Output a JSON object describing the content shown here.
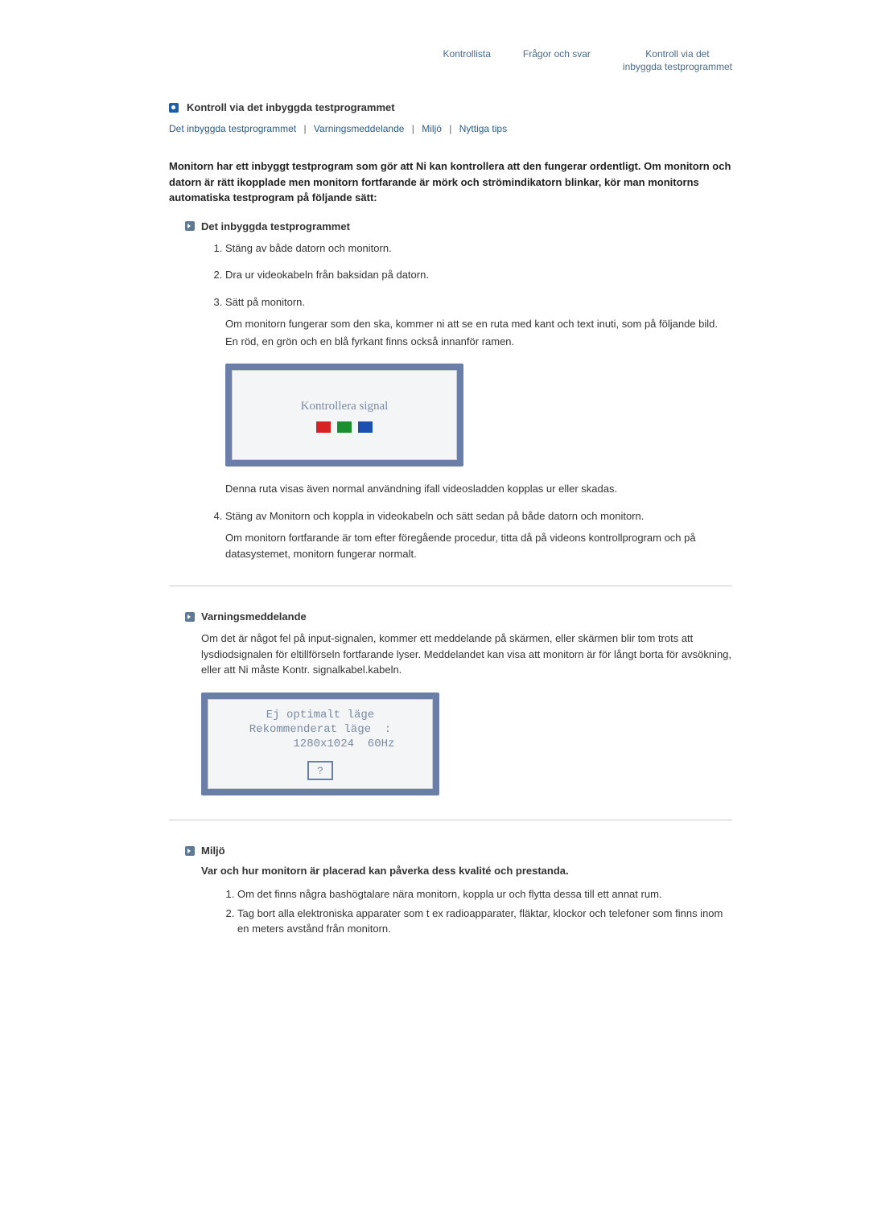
{
  "topnav": {
    "item1": "Kontrollista",
    "item2": "Frågor och svar",
    "item3_line1": "Kontroll via det",
    "item3_line2": "inbyggda testprogrammet"
  },
  "page_title": "Kontroll via det inbyggda testprogrammet",
  "jump_links": {
    "a": "Det inbyggda testprogrammet",
    "b": "Varningsmeddelande",
    "c": "Miljö",
    "d": "Nyttiga tips"
  },
  "intro": "Monitorn har ett inbyggt testprogram som gör att Ni kan kontrollera att den fungerar ordentligt. Om monitorn och datorn är rätt ikopplade men monitorn fortfarande är mörk och strömindikatorn blinkar, kör man monitorns automatiska testprogram på följande sätt:",
  "section1": {
    "heading": "Det inbyggda testprogrammet",
    "step1": "Stäng av både datorn och monitorn.",
    "step2": "Dra ur videokabeln från baksidan på datorn.",
    "step3": "Sätt på monitorn.",
    "step3_p1": "Om monitorn fungerar som den ska, kommer ni att se en ruta med kant och text inuti, som på följande bild.",
    "step3_p2": "En röd, en grön och en blå fyrkant finns också innanför ramen.",
    "box1_text": "Kontrollera signal",
    "step3_p3": "Denna ruta visas även normal användning ifall videosladden kopplas ur eller skadas.",
    "step4": "Stäng av Monitorn och koppla in videokabeln och sätt sedan på både datorn och monitorn.",
    "step4_p1": "Om monitorn fortfarande är tom efter föregående procedur, titta då på videons kontrollprogram och på datasystemet, monitorn fungerar normalt."
  },
  "section2": {
    "heading": "Varningsmeddelande",
    "para": "Om det är något fel på input-signalen, kommer ett meddelande på skärmen, eller skärmen blir tom trots att lysdiodsignalen för eltillförseln fortfarande lyser. Meddelandet kan visa att monitorn är för långt borta för avsökning, eller att Ni måste Kontr. signalkabel.kabeln.",
    "box2_text": "Ej optimalt läge\nRekommenderat läge  :\n       1280x1024  60Hz",
    "qmark": "?"
  },
  "section3": {
    "heading": "Miljö",
    "bold": "Var och hur monitorn är placerad kan påverka dess kvalité och prestanda.",
    "li1": "Om det finns några bashögtalare nära monitorn, koppla ur och flytta dessa till ett annat rum.",
    "li2": "Tag bort alla elektroniska apparater som t ex radioapparater, fläktar, klockor och telefoner som finns inom en meters avstånd från monitorn."
  }
}
